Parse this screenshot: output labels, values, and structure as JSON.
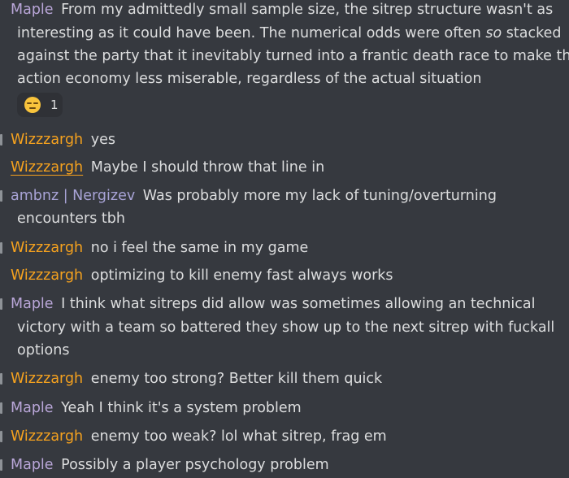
{
  "colors": {
    "background": "#36393f",
    "text": "#dcddde",
    "maple": "#b9a6d8",
    "wizzzargh": "#f6a21e",
    "ambnz": "#a8a3d6"
  },
  "messages": [
    {
      "author": "Maple",
      "lines": [
        "From my admittedly small sample size, the sitrep structure wasn't as",
        "interesting as it could have been. The numerical odds were often",
        "so",
        "stacked",
        "against the party that it inevitably turned into a frantic death race to make the",
        "action economy less miserable,  regardless of the actual situation"
      ],
      "reaction": {
        "emoji": "pensive-face-icon",
        "count": "1"
      }
    },
    {
      "author": "Wizzzargh",
      "lines": [
        "yes"
      ]
    },
    {
      "author": "Wizzzargh",
      "lines": [
        "Maybe I should throw that line in"
      ]
    },
    {
      "author": "ambnz | Nergizev",
      "lines": [
        "Was probably more my lack of tuning/overturning",
        "encounters tbh"
      ]
    },
    {
      "author": "Wizzzargh",
      "lines": [
        "no i feel the same in my game"
      ]
    },
    {
      "author": "Wizzzargh",
      "lines": [
        "optimizing to kill enemy fast always works"
      ]
    },
    {
      "author": "Maple",
      "lines": [
        "I think what sitreps did allow was sometimes allowing an technical",
        "victory with a team so battered they show up to the next sitrep with fuckall",
        "options"
      ]
    },
    {
      "author": "Wizzzargh",
      "lines": [
        "enemy too strong? Better kill them quick"
      ]
    },
    {
      "author": "Maple",
      "lines": [
        "Yeah I think it's a system problem"
      ]
    },
    {
      "author": "Wizzzargh",
      "lines": [
        "enemy too weak? lol what sitrep, frag em"
      ]
    },
    {
      "author": "Maple",
      "lines": [
        "Possibly a player psychology problem"
      ]
    }
  ]
}
